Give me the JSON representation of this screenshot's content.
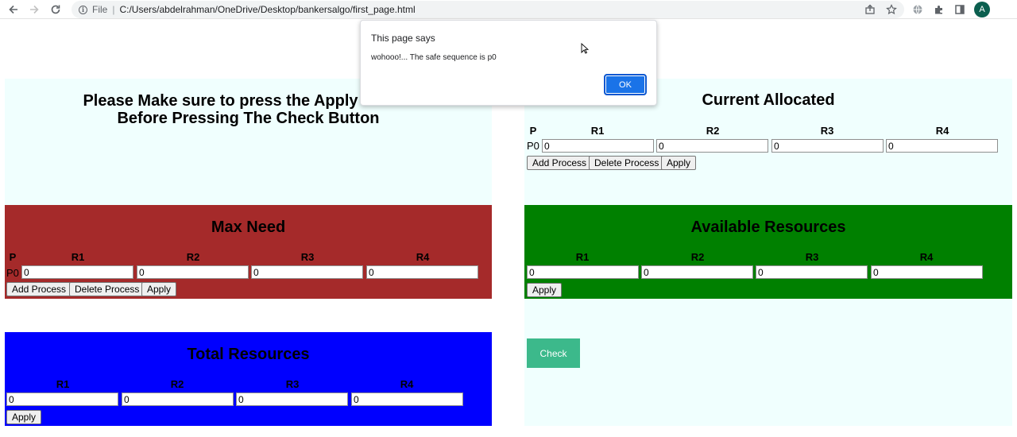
{
  "browser": {
    "scheme_label": "File",
    "url": "C:/Users/abdelrahman/OneDrive/Desktop/bankersalgo/first_page.html",
    "profile_initial": "A",
    "icons": [
      "back-icon",
      "forward-icon",
      "reload-icon",
      "info-icon",
      "share-icon",
      "star-icon",
      "translate-icon",
      "extensions-icon",
      "sidebar-icon"
    ]
  },
  "notice": {
    "line1": "Please Make sure to press the Apply Button",
    "line2": "Before Pressing The Check Button"
  },
  "current_allocated": {
    "title": "Current Allocated",
    "headers": [
      "P",
      "R1",
      "R2",
      "R3",
      "R4"
    ],
    "rows": [
      {
        "label": "P0",
        "values": [
          "0",
          "0",
          "0",
          "0"
        ]
      }
    ],
    "buttons": {
      "add": "Add Process",
      "delete": "Delete Process",
      "apply": "Apply"
    }
  },
  "max_need": {
    "title": "Max Need",
    "headers": [
      "P",
      "R1",
      "R2",
      "R3",
      "R4"
    ],
    "rows": [
      {
        "label": "P0",
        "values": [
          "0",
          "0",
          "0",
          "0"
        ]
      }
    ],
    "buttons": {
      "add": "Add Process",
      "delete": "Delete Process",
      "apply": "Apply"
    }
  },
  "available": {
    "title": "Available Resources",
    "headers": [
      "R1",
      "R2",
      "R3",
      "R4"
    ],
    "values": [
      "0",
      "0",
      "0",
      "0"
    ],
    "buttons": {
      "apply": "Apply"
    }
  },
  "total": {
    "title": "Total Resources",
    "headers": [
      "R1",
      "R2",
      "R3",
      "R4"
    ],
    "values": [
      "0",
      "0",
      "0",
      "0"
    ],
    "buttons": {
      "apply": "Apply"
    }
  },
  "check_label": "Check",
  "dialog": {
    "title": "This page says",
    "message": "wohooo!... The safe sequence is p0",
    "ok_label": "OK"
  },
  "colors": {
    "max_need_bg": "#a52a2a",
    "available_bg": "#008000",
    "total_bg": "#0000ff",
    "light_bg": "#f0fffe",
    "check_bg": "#3cb98b",
    "ok_bg": "#1a73e8"
  }
}
